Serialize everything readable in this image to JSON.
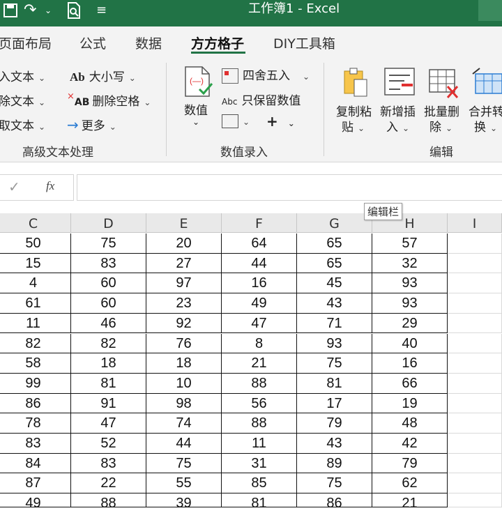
{
  "titlebar": {
    "title": "工作簿1  -  Excel"
  },
  "tabs": [
    {
      "label": "页面布局",
      "active": false
    },
    {
      "label": "公式",
      "active": false
    },
    {
      "label": "数据",
      "active": false
    },
    {
      "label": "方方格子",
      "active": true
    },
    {
      "label": "DIY工具箱",
      "active": false
    }
  ],
  "ribbon": {
    "text_group": {
      "items": [
        "入文本",
        "除文本",
        "取文本"
      ],
      "case_label": "大小写",
      "case_icon_text": "Ab",
      "remove_spaces_label": "删除空格",
      "remove_spaces_icon_text": "AB",
      "more_label": "更多",
      "group_label": "高级文本处理"
    },
    "value_group": {
      "numeric_label": "数值",
      "round_label": "四舍五入",
      "keep_values_label": "只保留数值",
      "keep_values_icon_text": "Abc",
      "plus_label": "+",
      "group_label": "数值录入"
    },
    "edit_group": {
      "copy_paste_line1": "复制粘",
      "copy_paste_line2": "贴",
      "insert_line1": "新增插",
      "insert_line2": "入",
      "delete_line1": "批量删",
      "delete_line2": "除",
      "merge_line1": "合并转",
      "merge_line2": "换",
      "group_label": "编辑"
    }
  },
  "formula_bar": {
    "fx_label": "fx",
    "value": "",
    "tooltip": "编辑栏"
  },
  "columns": [
    "C",
    "D",
    "E",
    "F",
    "G",
    "H",
    "I"
  ],
  "rows": [
    [
      50,
      75,
      20,
      64,
      65,
      57
    ],
    [
      15,
      83,
      27,
      44,
      65,
      32
    ],
    [
      4,
      60,
      97,
      16,
      45,
      93
    ],
    [
      61,
      60,
      23,
      49,
      43,
      93
    ],
    [
      11,
      46,
      92,
      47,
      71,
      29
    ],
    [
      82,
      82,
      76,
      8,
      93,
      40
    ],
    [
      58,
      18,
      18,
      21,
      75,
      16
    ],
    [
      99,
      81,
      10,
      88,
      81,
      66
    ],
    [
      86,
      91,
      98,
      56,
      17,
      19
    ],
    [
      78,
      47,
      74,
      88,
      79,
      48
    ],
    [
      83,
      52,
      44,
      11,
      43,
      42
    ],
    [
      84,
      83,
      75,
      31,
      89,
      79
    ],
    [
      87,
      22,
      55,
      85,
      75,
      62
    ],
    [
      49,
      88,
      39,
      81,
      86,
      21
    ]
  ],
  "colors": {
    "excel_green": "#217346",
    "ribbon_bg": "#f3f3f3",
    "accent_red": "#e03030",
    "accent_blue": "#2b7cd3"
  }
}
